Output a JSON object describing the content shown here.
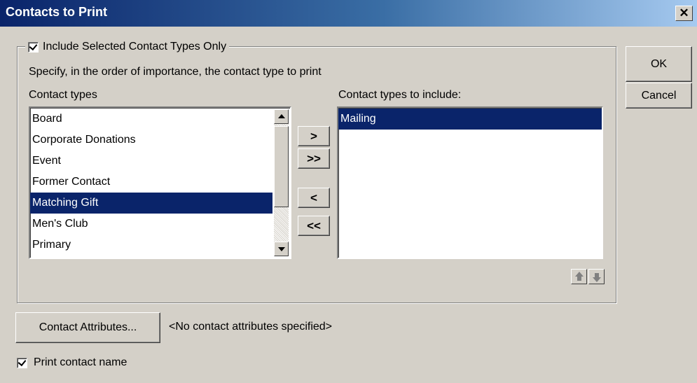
{
  "window": {
    "title": "Contacts to Print",
    "close_glyph": "✕"
  },
  "group": {
    "checkbox_label": "Include Selected Contact Types Only",
    "checked": true
  },
  "instructions": "Specify, in the order of importance, the contact type to print",
  "available": {
    "header": "Contact types",
    "items": [
      "Board",
      "Corporate Donations",
      "Event",
      "Former Contact",
      "Matching Gift",
      "Men's Club",
      "Primary"
    ],
    "selected": "Matching Gift"
  },
  "included": {
    "header": "Contact types to include:",
    "items": [
      "Mailing"
    ],
    "selected": "Mailing"
  },
  "move_buttons": {
    "add": ">",
    "add_all": ">>",
    "remove": "<",
    "remove_all": "<<"
  },
  "order_buttons": {
    "up_icon": "arrow-up-icon",
    "down_icon": "arrow-down-icon"
  },
  "buttons": {
    "ok": "OK",
    "cancel": "Cancel",
    "attributes": "Contact Attributes..."
  },
  "attributes_status": "<No contact attributes specified>",
  "print_name": {
    "label": "Print contact name",
    "checked": true
  },
  "colors": {
    "title_start": "#0a246a",
    "title_end": "#a6caf0",
    "selection": "#0a246a",
    "face": "#d4d0c8"
  }
}
